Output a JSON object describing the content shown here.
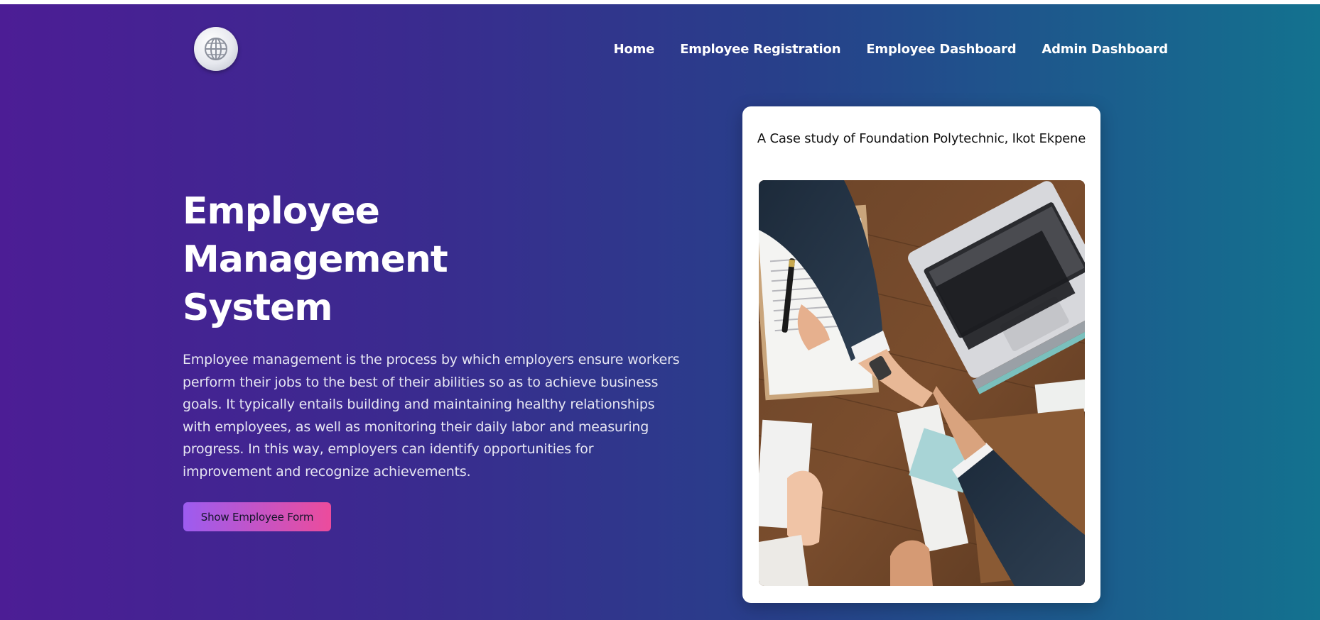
{
  "nav": {
    "logo_icon": "globe-icon",
    "links": [
      {
        "label": "Home"
      },
      {
        "label": "Employee Registration"
      },
      {
        "label": "Employee Dashboard"
      },
      {
        "label": "Admin Dashboard"
      }
    ]
  },
  "hero": {
    "title_lines": [
      "Employee",
      "Management",
      "System"
    ],
    "description": "Employee management is the process by which employers ensure workers perform their jobs to the best of their abilities so as to achieve business goals. It typically entails building and maintaining healthy relationships with employees, as well as monitoring their daily labor and measuring progress. In this way, employers can identify opportunities for improvement and recognize achievements.",
    "cta_label": "Show Employee Form"
  },
  "card": {
    "caption": "A Case study of Foundation Polytechnic, Ikot Ekpene",
    "image_description": "handshake-over-desk-photo"
  },
  "colors": {
    "gradient_start": "#4c1d95",
    "gradient_end": "#13728f",
    "button_start": "#9c5cf0",
    "button_end": "#ec4c9c"
  }
}
